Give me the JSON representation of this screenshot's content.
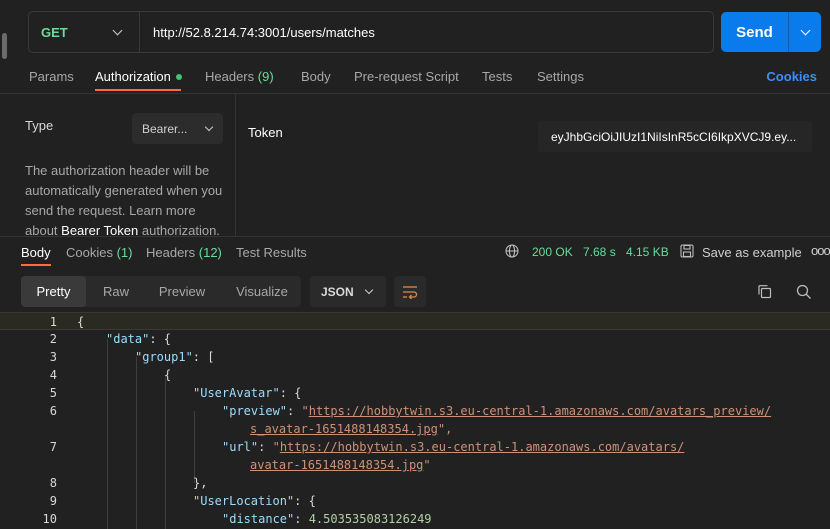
{
  "request": {
    "method": "GET",
    "url": "http://52.8.214.74:3001/users/matches",
    "send_label": "Send"
  },
  "req_tabs": {
    "params": "Params",
    "authorization": "Authorization",
    "headers": "Headers",
    "headers_count": "(9)",
    "body": "Body",
    "prerequest": "Pre-request Script",
    "tests": "Tests",
    "settings": "Settings",
    "cookies": "Cookies"
  },
  "auth": {
    "type_label": "Type",
    "type_value": "Bearer...",
    "help_text_1": "The authorization header will be automatically generated when you send the request. Learn more about ",
    "help_link": "Bearer Token",
    "help_text_2": " authorization.",
    "token_label": "Token",
    "token_value": "eyJhbGciOiJIUzI1NiIsInR5cCI6IkpXVCJ9.ey..."
  },
  "response": {
    "tabs": {
      "body": "Body",
      "cookies": "Cookies",
      "cookies_count": "(1)",
      "headers": "Headers",
      "headers_count": "(12)",
      "test_results": "Test Results"
    },
    "status": "200 OK",
    "time": "7.68 s",
    "size": "4.15 KB",
    "save_example": "Save as example",
    "more": "ooo",
    "format_buttons": [
      "Pretty",
      "Raw",
      "Preview",
      "Visualize"
    ],
    "language": "JSON"
  },
  "code_lines": {
    "n1": "1",
    "n2": "2",
    "n3": "3",
    "n4": "4",
    "n5": "5",
    "n6": "6",
    "n7": "7",
    "n8": "8",
    "n9": "9",
    "n10": "10",
    "t1": "{",
    "k2": "\"data\"",
    "t2": ": {",
    "k3": "\"group1\"",
    "t3": ": [",
    "t4": "{",
    "k5": "\"UserAvatar\"",
    "t5": ": {",
    "k6": "\"preview\"",
    "t6": ": ",
    "q6a": "\"",
    "u6a": "https://hobbytwin.s3.eu-central-1.amazonaws.com/avatars_preview/",
    "u6b": "s_avatar-1651488148354.jpg",
    "q6b": "\",",
    "k7": "\"url\"",
    "t7": ": ",
    "q7a": "\"",
    "u7a": "https://hobbytwin.s3.eu-central-1.amazonaws.com/avatars/",
    "u7b": "avatar-1651488148354.jpg",
    "q7b": "\"",
    "t8": "},",
    "k9": "\"UserLocation\"",
    "t9": ": {",
    "k10": "\"distance\"",
    "t10": ": ",
    "v10": "4.503535083126249"
  },
  "colors": {
    "accent": "#097bed",
    "tab_underline": "#ff6c37",
    "method_green": "#6bdd9a",
    "link_blue": "#3d8ef6"
  }
}
